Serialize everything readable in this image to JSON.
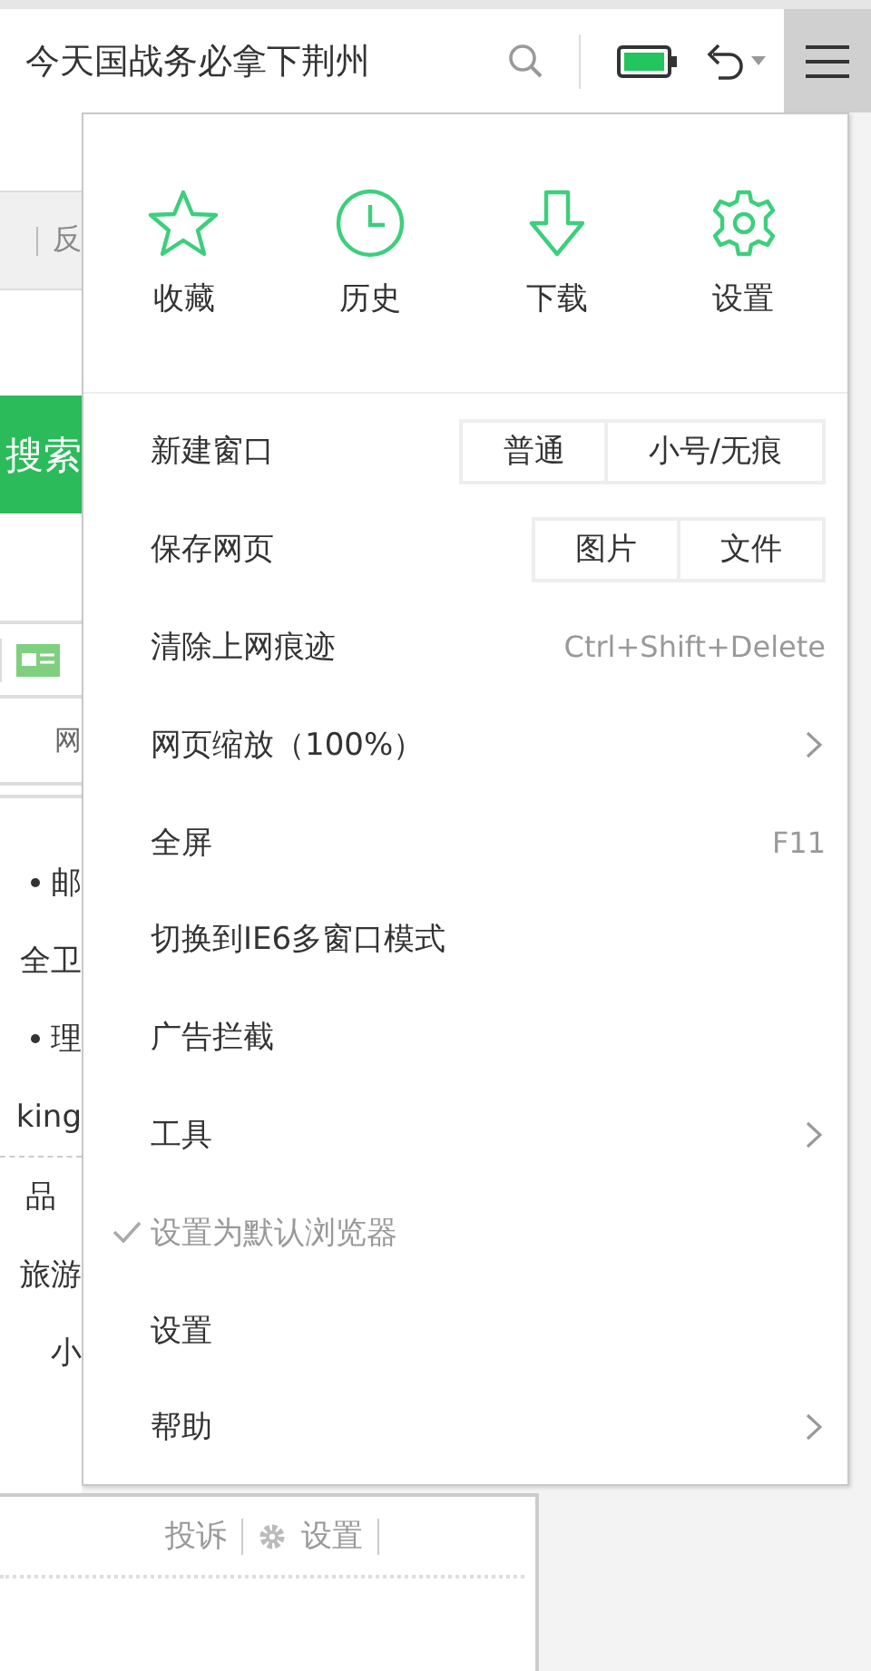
{
  "toolbar": {
    "address": "今天国战务必拿下荆州"
  },
  "background_page": {
    "top_link": "反",
    "search_button": "搜索",
    "tab_text": "网",
    "lines": [
      {
        "kind": "bullet",
        "text": "邮"
      },
      {
        "kind": "plain",
        "text": "全卫"
      },
      {
        "kind": "bullet",
        "text": "理"
      },
      {
        "kind": "plain",
        "text": "king"
      },
      {
        "kind": "divider",
        "text": "品"
      },
      {
        "kind": "plain",
        "text": "旅游"
      },
      {
        "kind": "plain",
        "text": "小"
      }
    ],
    "footer_links": [
      "投诉",
      "设置"
    ]
  },
  "menu": {
    "quick_actions": [
      {
        "kind": "star",
        "label": "收藏"
      },
      {
        "kind": "clock",
        "label": "历史"
      },
      {
        "kind": "download",
        "label": "下载"
      },
      {
        "kind": "gear",
        "label": "设置"
      }
    ],
    "items": [
      {
        "kind": "buttons",
        "label": "新建窗口",
        "buttons": [
          "普通",
          "小号/无痕"
        ]
      },
      {
        "kind": "buttons",
        "label": "保存网页",
        "buttons": [
          "图片",
          "文件"
        ]
      },
      {
        "kind": "shortcut",
        "label": "清除上网痕迹",
        "shortcut": "Ctrl+Shift+Delete"
      },
      {
        "kind": "submenu",
        "label": "网页缩放（100%）"
      },
      {
        "kind": "shortcut",
        "label": "全屏",
        "shortcut": "F11"
      },
      {
        "kind": "plain",
        "label": "切换到IE6多窗口模式"
      },
      {
        "kind": "plain",
        "label": "广告拦截"
      },
      {
        "kind": "submenu",
        "label": "工具"
      },
      {
        "kind": "check",
        "label": "设置为默认浏览器",
        "checked": true
      },
      {
        "kind": "plain",
        "label": "设置"
      },
      {
        "kind": "submenu",
        "label": "帮助"
      }
    ]
  }
}
